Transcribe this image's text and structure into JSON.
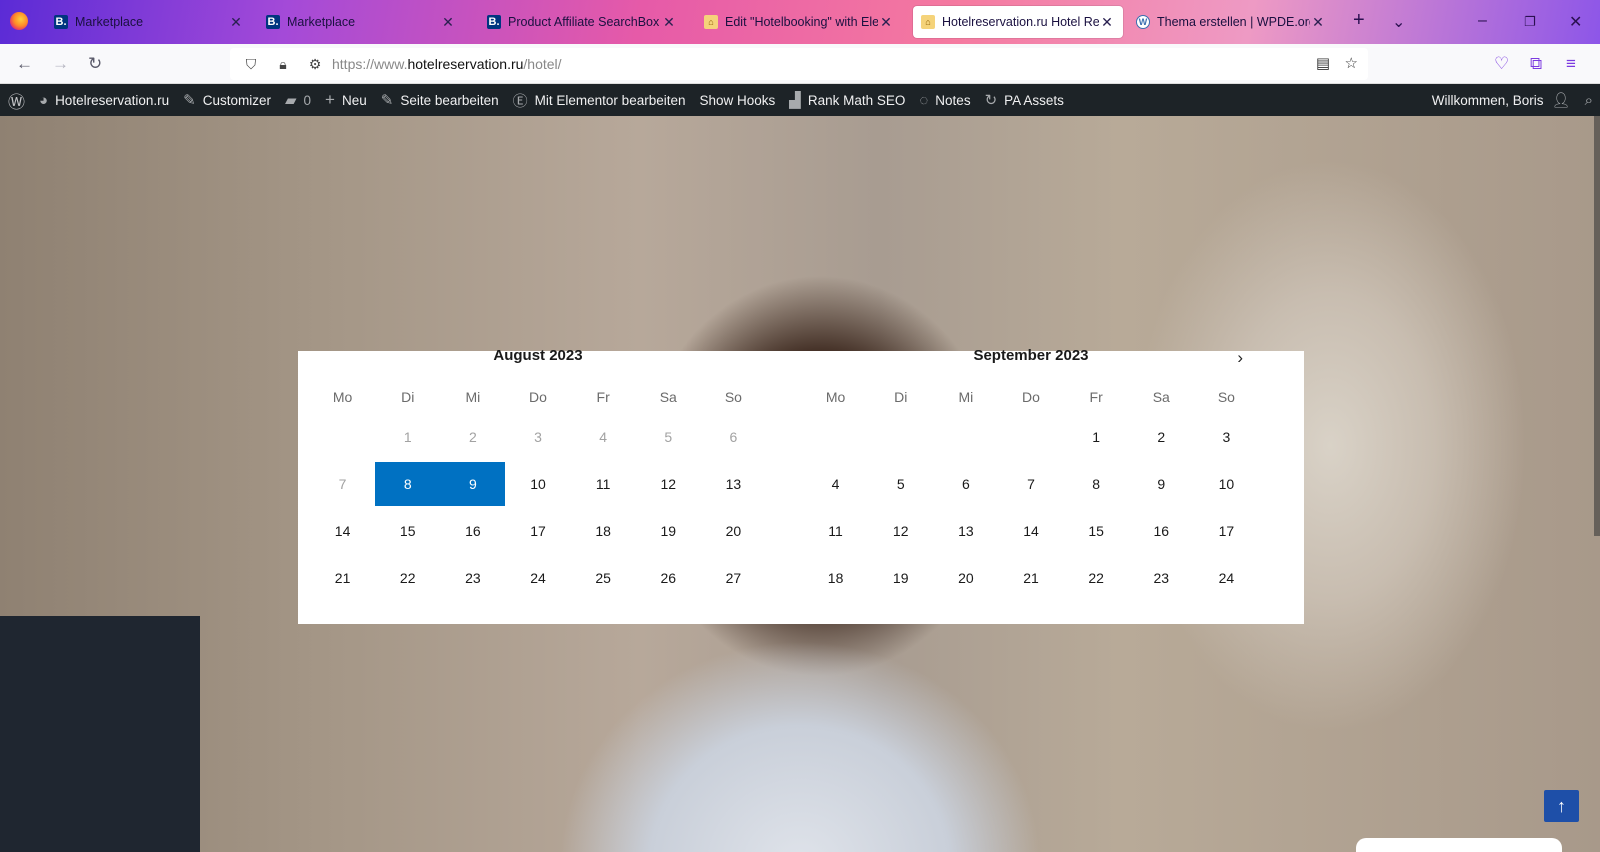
{
  "browser": {
    "tabs": [
      {
        "title": "Marketplace",
        "icon": "booking-icon",
        "active": false
      },
      {
        "title": "Marketplace",
        "icon": "booking-icon",
        "active": false
      },
      {
        "title": "Product Affiliate SearchBox W",
        "icon": "booking-icon",
        "active": false
      },
      {
        "title": "Edit \"Hotelbooking\" with Elem",
        "icon": "home-icon",
        "active": false
      },
      {
        "title": "Hotelreservation.ru Hotel Rese",
        "icon": "home-icon",
        "active": true
      },
      {
        "title": "Thema erstellen | WPDE.org Fo",
        "icon": "wordpress-icon",
        "active": false
      }
    ],
    "url_prefix": "https://www.",
    "url_domain": "hotelreservation.ru",
    "url_path": "/hotel/"
  },
  "adminbar": {
    "site_name": "Hotelreservation.ru",
    "customizer": "Customizer",
    "comments_count": "0",
    "new": "Neu",
    "edit_page": "Seite bearbeiten",
    "elementor": "Mit Elementor bearbeiten",
    "show_hooks": "Show Hooks",
    "rank_math": "Rank Math SEO",
    "notes": "Notes",
    "pa_assets": "PA Assets",
    "greeting": "Willkommen, Boris"
  },
  "calendar": {
    "weekdays": [
      "Mo",
      "Di",
      "Mi",
      "Do",
      "Fr",
      "Sa",
      "So"
    ],
    "august": {
      "title": "August 2023",
      "rows": [
        [
          "",
          "1",
          "2",
          "3",
          "4",
          "5",
          "6"
        ],
        [
          "7",
          "8",
          "9",
          "10",
          "11",
          "12",
          "13"
        ],
        [
          "14",
          "15",
          "16",
          "17",
          "18",
          "19",
          "20"
        ],
        [
          "21",
          "22",
          "23",
          "24",
          "25",
          "26",
          "27"
        ]
      ],
      "disabled_days": [
        "1",
        "2",
        "3",
        "4",
        "5",
        "6",
        "7"
      ],
      "selected_days": [
        "8",
        "9"
      ]
    },
    "september": {
      "title": "September 2023",
      "rows": [
        [
          "",
          "",
          "",
          "",
          "1",
          "2",
          "3"
        ],
        [
          "4",
          "5",
          "6",
          "7",
          "8",
          "9",
          "10"
        ],
        [
          "11",
          "12",
          "13",
          "14",
          "15",
          "16",
          "17"
        ],
        [
          "18",
          "19",
          "20",
          "21",
          "22",
          "23",
          "24"
        ]
      ]
    }
  },
  "colors": {
    "selected": "#0071c2",
    "adminbar": "#1d2327",
    "to_top": "#1e4fa8"
  }
}
